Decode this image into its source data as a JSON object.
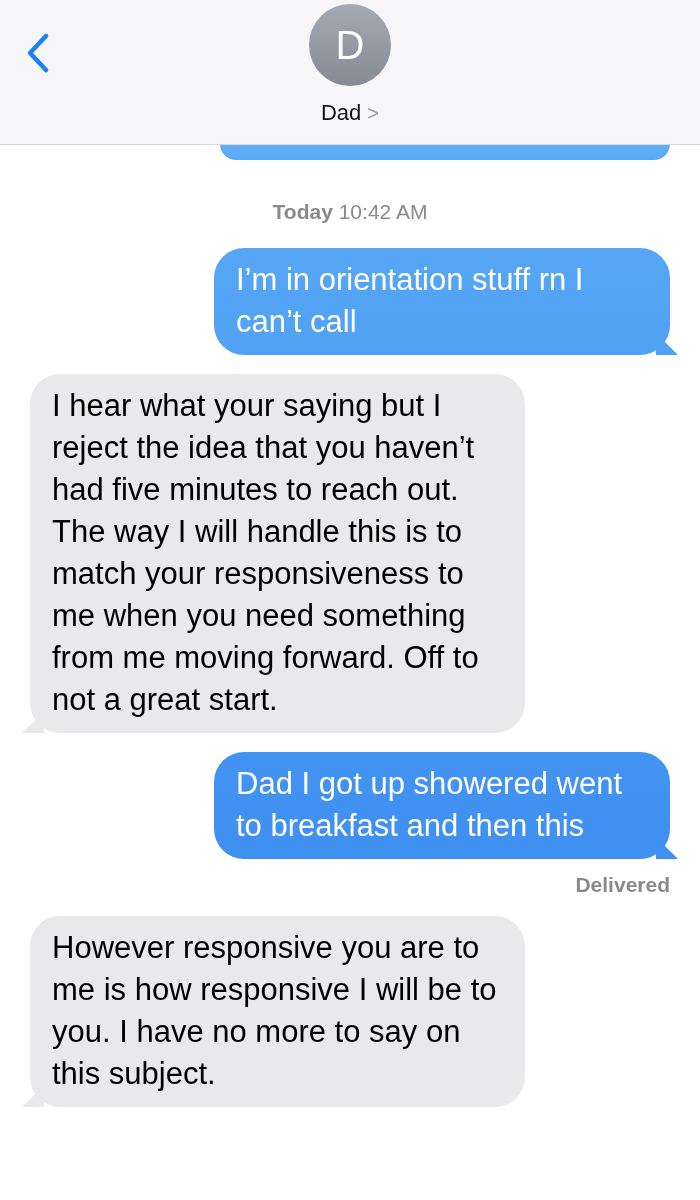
{
  "header": {
    "avatar_letter": "D",
    "contact_name": "Dad",
    "chevron": ">"
  },
  "previous_bubble": {
    "kind": "sent"
  },
  "timestamp": "**Today** 10:42 AM",
  "messages": [
    {
      "kind": "sent",
      "text": "I’m in orientation stuff rn I can’t call"
    },
    {
      "kind": "received",
      "text": "I hear what your saying but I reject the idea that you haven’t had five minutes to reach out. The way I will handle this is to match your responsiveness to me when you need something from me moving forward. Off to not a great start."
    },
    {
      "kind": "sent",
      "text": "Dad I got up showered went to breakfast and then this",
      "status": "Delivered"
    },
    {
      "kind": "received",
      "text": "However responsive you are to me is how responsive I will be to you. I have no more to say on this subject."
    }
  ]
}
